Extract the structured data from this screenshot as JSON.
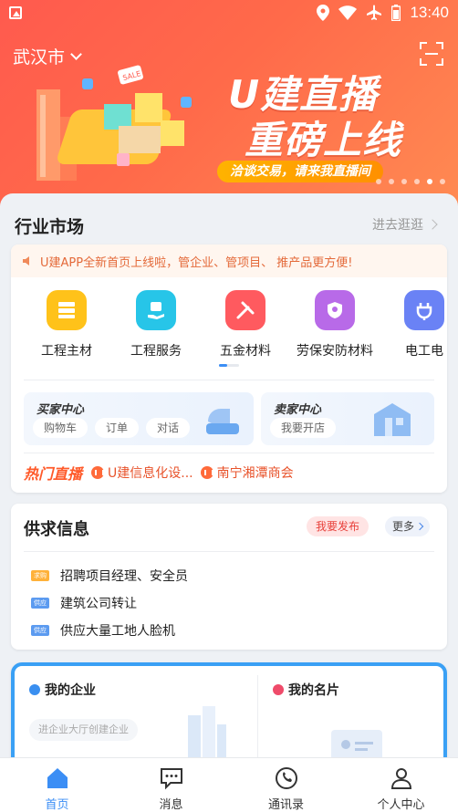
{
  "status_bar": {
    "time": "13:40"
  },
  "header": {
    "city": "武汉市"
  },
  "banner": {
    "slogan_line1": "U建直播",
    "slogan_line2": "重磅上线",
    "tagline": "洽谈交易，请来我直播间",
    "sale_tag": "SALE"
  },
  "market": {
    "title": "行业市场",
    "link": "进去逛逛",
    "notice": "U建APP全新首页上线啦，管企业、管项目、 推产品更方便!",
    "categories": [
      {
        "label": "工程主材",
        "color": "#ffc21a"
      },
      {
        "label": "工程服务",
        "color": "#27c5e8"
      },
      {
        "label": "五金材料",
        "color": "#ff5a5f"
      },
      {
        "label": "劳保安防材料",
        "color": "#b86ae8"
      },
      {
        "label": "电工电",
        "color": "#6a82f5"
      }
    ],
    "buyer_center": {
      "title": "买家中心",
      "buttons": [
        "购物车",
        "订单",
        "对话"
      ]
    },
    "seller_center": {
      "title": "卖家中心",
      "buttons": [
        "我要开店"
      ]
    },
    "live": {
      "logo": "热门直播",
      "items": [
        "U建信息化设...",
        "南宁湘潭商会"
      ]
    }
  },
  "supply": {
    "title": "供求信息",
    "publish": "我要发布",
    "more": "更多",
    "items": [
      {
        "tag": "求购",
        "tag_color": "#ffb13a",
        "text": "招聘项目经理、安全员"
      },
      {
        "tag": "供应",
        "tag_color": "#5c9bf0",
        "text": "建筑公司转让"
      },
      {
        "tag": "供应",
        "tag_color": "#5c9bf0",
        "text": "供应大量工地人脸机"
      }
    ]
  },
  "company": {
    "my_company": "我的企业",
    "create_hint": "进企业大厅创建企业",
    "my_card": "我的名片"
  },
  "nav": [
    {
      "label": "首页"
    },
    {
      "label": "消息"
    },
    {
      "label": "通讯录"
    },
    {
      "label": "个人中心"
    }
  ]
}
